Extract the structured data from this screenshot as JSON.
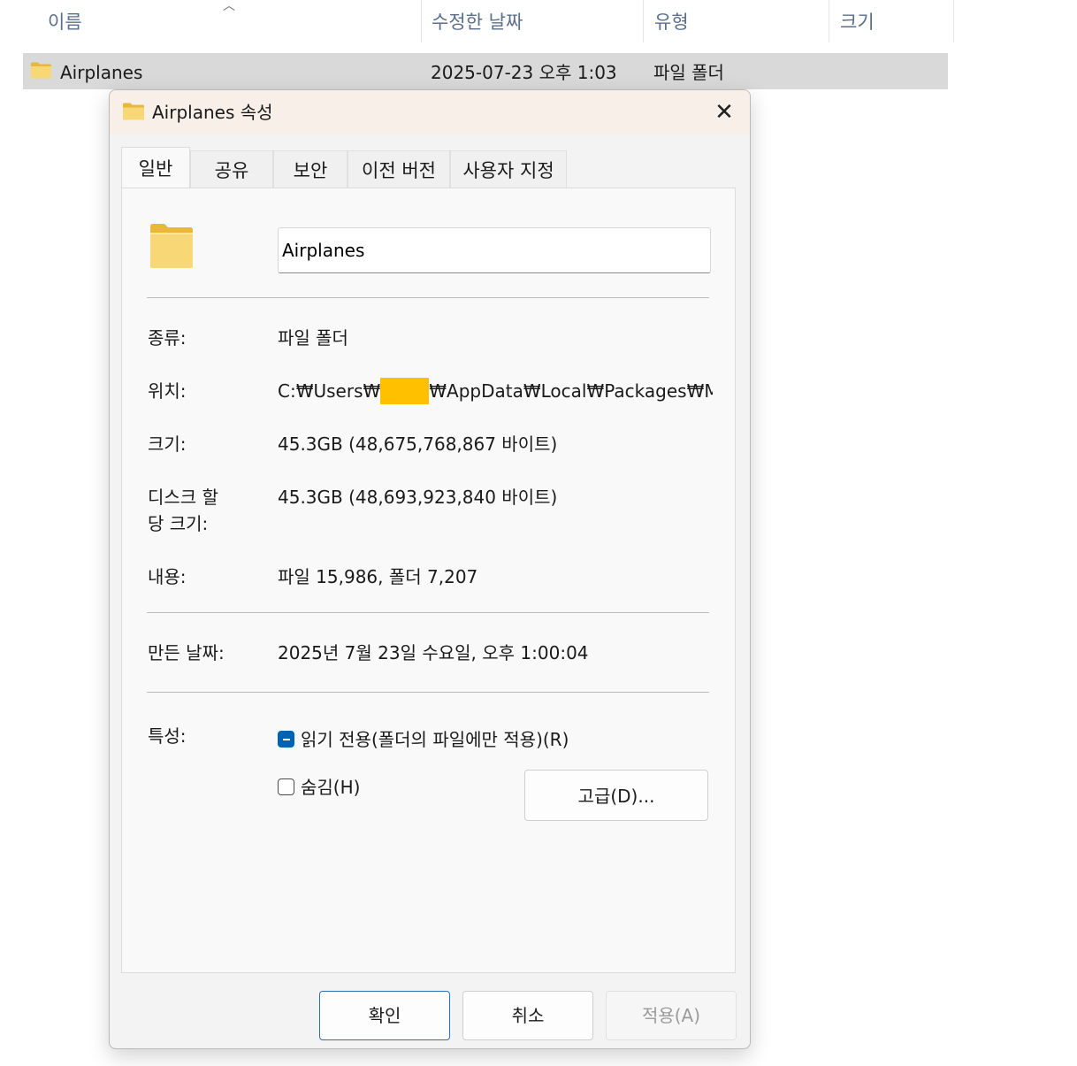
{
  "explorer": {
    "columns": [
      "이름",
      "수정한 날짜",
      "유형",
      "크기"
    ],
    "row": {
      "name": "Airplanes",
      "modified": "2025-07-23 오후 1:03",
      "type": "파일 폴더",
      "size": ""
    }
  },
  "dialog": {
    "title": "Airplanes 속성",
    "close_glyph": "✕",
    "tabs": [
      "일반",
      "공유",
      "보안",
      "이전 버전",
      "사용자 지정"
    ],
    "active_tab": "일반",
    "name_value": "Airplanes",
    "fields": {
      "type_label": "종류:",
      "type_value": "파일 폴더",
      "location_label": "위치:",
      "location_prefix": "C:₩Users₩",
      "location_suffix": "₩AppData₩Local₩Packages₩Micros",
      "size_label": "크기:",
      "size_value": "45.3GB (48,675,768,867 바이트)",
      "disk_size_label_line1": "디스크 할",
      "disk_size_label_line2": "당 크기:",
      "disk_size_value": "45.3GB (48,693,923,840 바이트)",
      "contents_label": "내용:",
      "contents_value": "파일 15,986, 폴더 7,207",
      "created_label": "만든 날짜:",
      "created_value": "2025년 7월 23일 수요일, 오후 1:00:04",
      "attributes_label": "특성:"
    },
    "attributes": {
      "readonly_label": "읽기 전용(폴더의 파일에만 적용)(R)",
      "readonly_state": "indeterminate",
      "hidden_label": "숨김(H)",
      "hidden_state": "unchecked",
      "advanced_button": "고급(D)..."
    },
    "buttons": {
      "ok": "확인",
      "cancel": "취소",
      "apply": "적용(A)"
    }
  },
  "colors": {
    "folder_yellow": "#f8d776",
    "folder_dark": "#e9b83b",
    "selection": "#d9d9d9",
    "titlebar": "#f7efe8",
    "accent": "#0063b1",
    "redaction": "#ffc000"
  }
}
